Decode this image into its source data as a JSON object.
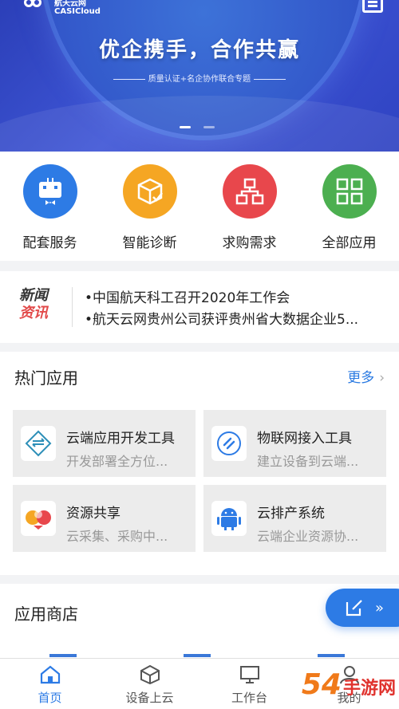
{
  "colors": {
    "brand_blue": "#2d7be5",
    "banner_blue": "#3348c6",
    "news_red": "#e24a4a",
    "orange_brand": "#f07a1a"
  },
  "banner": {
    "logo_text_cn": "航天云网",
    "logo_text_en": "CASICloud",
    "headline": "优企携手，合作共赢",
    "subline": "质量认证+名企协作联合专题"
  },
  "quick_menu": [
    {
      "label": "配套服务",
      "icon": "robot-icon",
      "color": "#2d7be5"
    },
    {
      "label": "智能诊断",
      "icon": "box-check-icon",
      "color": "#f5a623"
    },
    {
      "label": "求购需求",
      "icon": "org-chart-icon",
      "color": "#e8474c"
    },
    {
      "label": "全部应用",
      "icon": "grid-icon",
      "color": "#4caf50"
    }
  ],
  "news": {
    "badge_line1": "新闻",
    "badge_line2": "资讯",
    "items": [
      "•中国航天科工召开2020年工作会",
      "•航天云网贵州公司获评贵州省大数据企业5..."
    ]
  },
  "hot_apps": {
    "title": "热门应用",
    "more_label": "更多",
    "items": [
      {
        "title": "云端应用开发工具",
        "subtitle": "开发部署全方位...",
        "icon": "code-diamond-icon"
      },
      {
        "title": "物联网接入工具",
        "subtitle": "建立设备到云端...",
        "icon": "iot-link-icon"
      },
      {
        "title": "资源共享",
        "subtitle": "云采集、采购中...",
        "icon": "resource-share-icon"
      },
      {
        "title": "云排产系统",
        "subtitle": "云端企业资源协...",
        "icon": "android-icon"
      }
    ]
  },
  "store": {
    "title": "应用商店"
  },
  "tabbar": [
    {
      "label": "首页",
      "icon": "home-icon",
      "active": true
    },
    {
      "label": "设备上云",
      "icon": "cube-icon",
      "active": false
    },
    {
      "label": "工作台",
      "icon": "monitor-icon",
      "active": false
    },
    {
      "label": "我的",
      "icon": "user-icon",
      "active": false
    }
  ],
  "watermark": {
    "number": "54",
    "text": "手游网"
  }
}
